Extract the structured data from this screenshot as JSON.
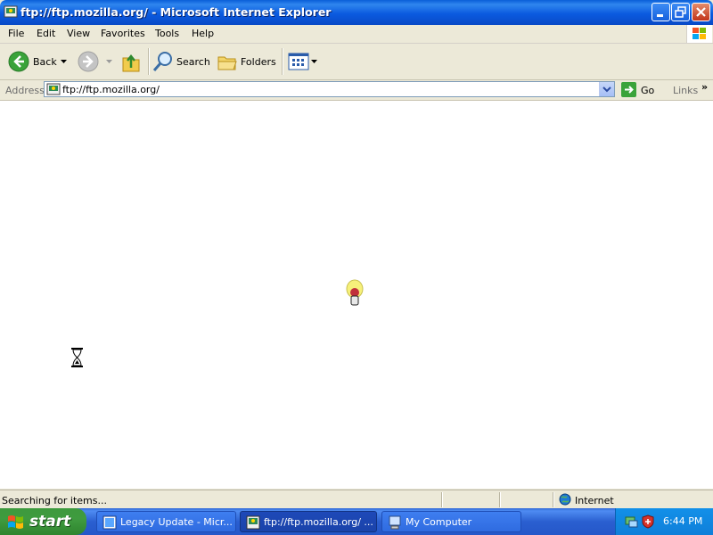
{
  "window": {
    "title": "ftp://ftp.mozilla.org/ - Microsoft Internet Explorer"
  },
  "menu": [
    "File",
    "Edit",
    "View",
    "Favorites",
    "Tools",
    "Help"
  ],
  "toolbar": {
    "back_label": "Back",
    "search_label": "Search",
    "folders_label": "Folders"
  },
  "address": {
    "label": "Address",
    "value": "ftp://ftp.mozilla.org/",
    "go_label": "Go",
    "links_label": "Links"
  },
  "status": {
    "text": "Searching for items...",
    "zone": "Internet"
  },
  "taskbar": {
    "start_label": "start",
    "tasks": [
      {
        "label": "Legacy Update - Micr...",
        "active": false
      },
      {
        "label": "ftp://ftp.mozilla.org/ ...",
        "active": true
      },
      {
        "label": "My Computer",
        "active": false
      }
    ],
    "clock": "6:44 PM"
  },
  "colors": {
    "title_bar": "#0b5be0",
    "taskbar": "#2a5fd0",
    "start_button": "#3f9b3f",
    "tray": "#0f7fd9"
  }
}
